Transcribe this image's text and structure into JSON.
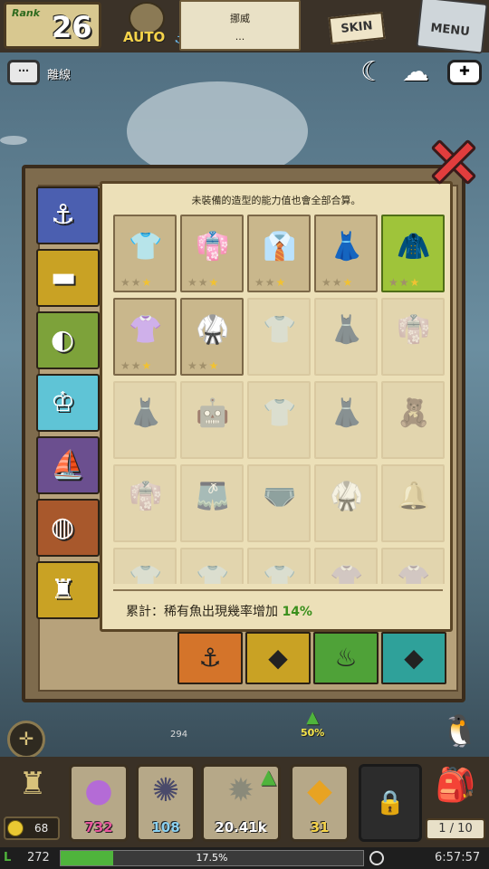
{
  "topbar": {
    "rank_label": "Rank",
    "rank_value": "26",
    "auto_label": "AUTO",
    "name_line1": "挪威",
    "name_line2": "...",
    "skin_label": "SKIN",
    "menu_label": "MENU"
  },
  "status": {
    "offline_label": "離線"
  },
  "panel": {
    "hint": "未裝備的造型的能力值也會全部合算。",
    "summary_label": "累計：稀有魚出現幾率增加 ",
    "summary_value": "14%",
    "tabs": [
      {
        "name": "tab-rod",
        "color": "#4b5fb0",
        "icon": "fishing-rod-icon",
        "glyph": "⚓"
      },
      {
        "name": "tab-hat",
        "color": "#c9a224",
        "icon": "hat-icon",
        "glyph": "▬"
      },
      {
        "name": "tab-hair",
        "color": "#7da23a",
        "icon": "hair-icon",
        "glyph": "◐"
      },
      {
        "name": "tab-outfit",
        "color": "#5fc4d6",
        "icon": "outfit-icon",
        "glyph": "♔"
      },
      {
        "name": "tab-boat",
        "color": "#6b4f8f",
        "icon": "boat-icon",
        "glyph": "⛵"
      },
      {
        "name": "tab-bag",
        "color": "#a8582c",
        "icon": "bag-icon",
        "glyph": "◍"
      },
      {
        "name": "tab-lantern",
        "color": "#c9a224",
        "icon": "lantern-icon",
        "glyph": "♜"
      }
    ],
    "items": [
      {
        "state": "owned",
        "stars": 1,
        "glyph": "👕",
        "color": "#8a8a6a"
      },
      {
        "state": "owned",
        "stars": 1,
        "glyph": "👘",
        "color": "#7a4a3a"
      },
      {
        "state": "owned",
        "stars": 1,
        "glyph": "👔",
        "color": "#3a3a5a"
      },
      {
        "state": "owned",
        "stars": 1,
        "glyph": "👗",
        "color": "#5a3a6a"
      },
      {
        "state": "selected",
        "stars": 1,
        "glyph": "🧥",
        "color": "#5a3a2a"
      },
      {
        "state": "owned",
        "stars": 1,
        "glyph": "👚",
        "color": "#6aa05a"
      },
      {
        "state": "owned",
        "stars": 1,
        "glyph": "🥋",
        "color": "#3a4a6a"
      },
      {
        "state": "locked",
        "stars": 0,
        "glyph": "👕",
        "color": "#9a8a7a"
      },
      {
        "state": "locked",
        "stars": 0,
        "glyph": "👗",
        "color": "#9aaab0"
      },
      {
        "state": "locked",
        "stars": 0,
        "glyph": "👘",
        "color": "#9a8a7a"
      },
      {
        "state": "locked",
        "stars": 0,
        "glyph": "👗",
        "color": "#a8a08a"
      },
      {
        "state": "locked",
        "stars": 0,
        "glyph": "🤖",
        "color": "#7a7a7a"
      },
      {
        "state": "locked",
        "stars": 0,
        "glyph": "👕",
        "color": "#c8b84a"
      },
      {
        "state": "locked",
        "stars": 0,
        "glyph": "👗",
        "color": "#b05a5a"
      },
      {
        "state": "locked",
        "stars": 0,
        "glyph": "🧸",
        "color": "#6a5a4a"
      },
      {
        "state": "locked",
        "stars": 0,
        "glyph": "👘",
        "color": "#c86a3a"
      },
      {
        "state": "locked",
        "stars": 0,
        "glyph": "🩳",
        "color": "#b04a3a"
      },
      {
        "state": "locked",
        "stars": 0,
        "glyph": "🩲",
        "color": "#7a8aa0"
      },
      {
        "state": "locked",
        "stars": 0,
        "glyph": "🥋",
        "color": "#c89a9a"
      },
      {
        "state": "locked",
        "stars": 0,
        "glyph": "🔔",
        "color": "#c8a83a"
      },
      {
        "state": "locked",
        "stars": 0,
        "glyph": "👕",
        "color": "#9a9a8a"
      },
      {
        "state": "locked",
        "stars": 0,
        "glyph": "👕",
        "color": "#8a9ab0"
      },
      {
        "state": "locked",
        "stars": 0,
        "glyph": "👕",
        "color": "#a86a5a"
      },
      {
        "state": "locked",
        "stars": 0,
        "glyph": "👚",
        "color": "#a88a6a"
      },
      {
        "state": "locked",
        "stars": 0,
        "glyph": "👚",
        "color": "#a89a8a"
      }
    ],
    "equip": [
      {
        "name": "equip-hook",
        "color": "#d4742a",
        "glyph": "⚓",
        "icon": "hook-icon"
      },
      {
        "name": "equip-bucket",
        "color": "#c9a224",
        "glyph": "◆",
        "icon": "bucket-icon"
      },
      {
        "name": "equip-spray",
        "color": "#4fa238",
        "glyph": "♨",
        "icon": "spray-icon"
      },
      {
        "name": "equip-gem",
        "color": "#2fa19a",
        "glyph": "◆",
        "icon": "gem-icon"
      }
    ]
  },
  "hud": {
    "depth_value": "294",
    "boost_value": "50%",
    "coin_value": "68",
    "resources": [
      {
        "name": "resource-orb",
        "value": "732",
        "color": "#e8589c",
        "glyph": "●",
        "icon": "orb-icon",
        "glyph_color": "#b46bd6"
      },
      {
        "name": "resource-web",
        "value": "108",
        "color": "#8ad0f0",
        "glyph": "✺",
        "icon": "web-icon",
        "glyph_color": "#4a4a6a"
      },
      {
        "name": "resource-shell",
        "value": "20.41k",
        "color": "#ffffff",
        "glyph": "✹",
        "icon": "shell-icon",
        "glyph_color": "#8a8a7a"
      },
      {
        "name": "resource-gold",
        "value": "31",
        "color": "#f5d34a",
        "glyph": "◆",
        "icon": "gold-ore-icon",
        "glyph_color": "#e8a322"
      }
    ],
    "bag_count": "1 / 10",
    "level": "272",
    "exp_progress": 0.175,
    "exp_text": "17.5%",
    "time": "6:57:57"
  }
}
